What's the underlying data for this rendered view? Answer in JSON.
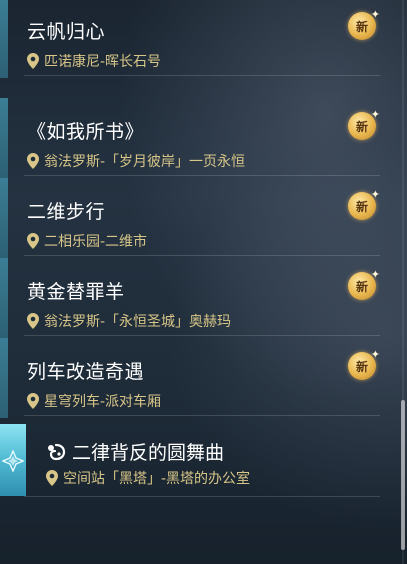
{
  "missions": [
    {
      "title": "云帆归心",
      "location": "匹诺康尼-晖长石号",
      "badge": "新"
    },
    {
      "title": "《如我所书》",
      "location": "翁法罗斯-「岁月彼岸」一页永恒",
      "badge": "新"
    },
    {
      "title": "二维步行",
      "location": "二相乐园-二维市",
      "badge": "新"
    },
    {
      "title": "黄金替罪羊",
      "location": "翁法罗斯-「永恒圣城」奥赫玛",
      "badge": "新"
    },
    {
      "title": "列车改造奇遇",
      "location": "星穹列车-派对车厢",
      "badge": "新"
    }
  ],
  "selected": {
    "title": "二律背反的圆舞曲",
    "location": "空间站「黑塔」-黑塔的办公室"
  },
  "colors": {
    "accent_bar": "#3b7e95",
    "location_text": "#d8c688",
    "badge_gold": "#e8b54c",
    "selected_tile": "#4fb9d2"
  },
  "icons": [
    "location-pin-icon",
    "new-badge-icon",
    "quest-type-icon",
    "diamond-icon",
    "sparkle-icon"
  ]
}
